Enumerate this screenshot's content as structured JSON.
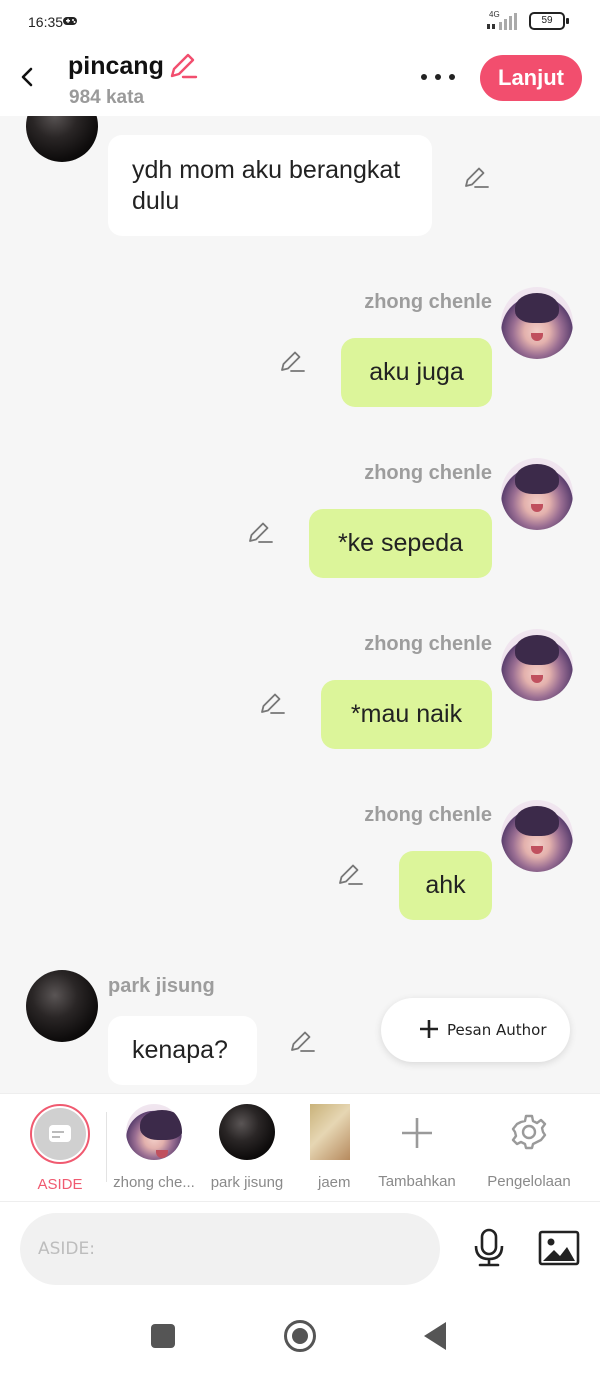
{
  "status_bar": {
    "time": "16:35",
    "network": "4G",
    "battery": "59"
  },
  "header": {
    "title": "pincang",
    "word_count": "984 kata",
    "next_label": "Lanjut"
  },
  "messages": [
    {
      "side": "left",
      "sender": "",
      "text": "ydh mom aku berangkat dulu"
    },
    {
      "side": "right",
      "sender": "zhong chenle",
      "text": "aku juga"
    },
    {
      "side": "right",
      "sender": "zhong chenle",
      "text": "*ke sepeda"
    },
    {
      "side": "right",
      "sender": "zhong chenle",
      "text": "*mau naik"
    },
    {
      "side": "right",
      "sender": "zhong chenle",
      "text": "ahk"
    },
    {
      "side": "left",
      "sender": "park jisung",
      "text": "kenapa?"
    }
  ],
  "pesan_author": {
    "label": "Pesan Author"
  },
  "characters": [
    {
      "label": "ASIDE",
      "active": true
    },
    {
      "label": "zhong che..."
    },
    {
      "label": "park jisung"
    },
    {
      "label": "jaem"
    },
    {
      "label": "Tambahkan"
    },
    {
      "label": "Pengelolaan"
    }
  ],
  "input": {
    "placeholder": "ASIDE:"
  },
  "colors": {
    "accent": "#f24e6e",
    "bubble_right": "#dcf59a",
    "bubble_left": "#ffffff"
  }
}
